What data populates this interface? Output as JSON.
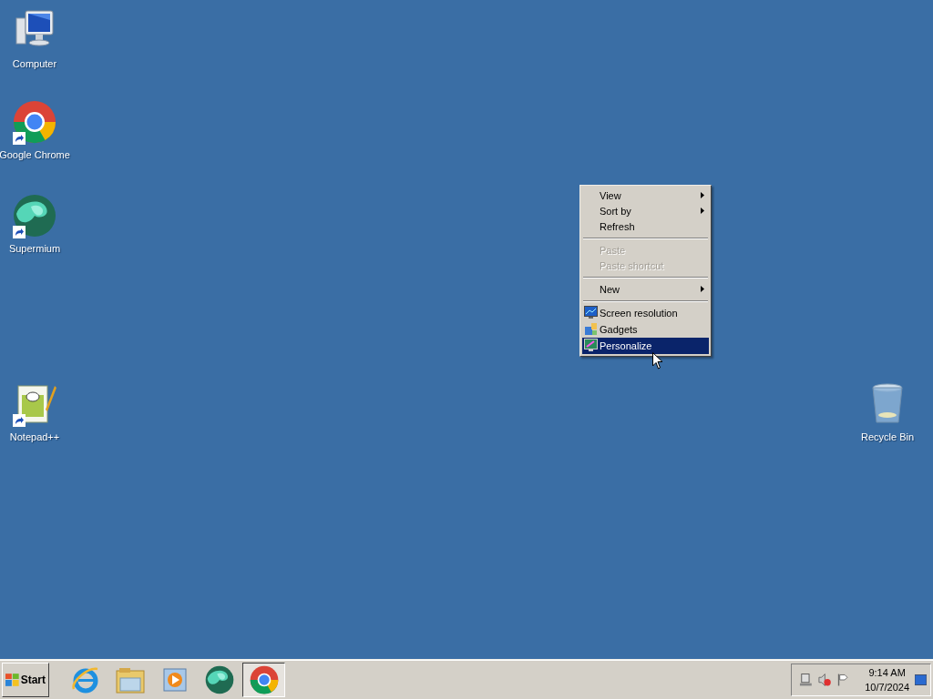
{
  "desktop_icons": [
    {
      "label": "Computer",
      "kind": "computer",
      "shortcut": false
    },
    {
      "label": "Google Chrome",
      "kind": "chrome",
      "shortcut": true
    },
    {
      "label": "Supermium",
      "kind": "supermium",
      "shortcut": true
    },
    {
      "label": "Notepad++",
      "kind": "notepad",
      "shortcut": true
    },
    {
      "label": "Recycle Bin",
      "kind": "recycle",
      "shortcut": false
    }
  ],
  "context_menu": {
    "items": [
      {
        "kind": "item",
        "label": "View",
        "submenu": true,
        "disabled": false,
        "selected": false
      },
      {
        "kind": "item",
        "label": "Sort by",
        "submenu": true,
        "disabled": false,
        "selected": false
      },
      {
        "kind": "item",
        "label": "Refresh",
        "submenu": false,
        "disabled": false,
        "selected": false
      },
      {
        "kind": "separator"
      },
      {
        "kind": "item",
        "label": "Paste",
        "submenu": false,
        "disabled": true,
        "selected": false
      },
      {
        "kind": "item",
        "label": "Paste shortcut",
        "submenu": false,
        "disabled": true,
        "selected": false
      },
      {
        "kind": "separator"
      },
      {
        "kind": "item",
        "label": "New",
        "submenu": true,
        "disabled": false,
        "selected": false
      },
      {
        "kind": "separator"
      },
      {
        "kind": "resolution",
        "label": "Screen resolution",
        "submenu": false,
        "disabled": false,
        "selected": false
      },
      {
        "kind": "gadgets",
        "label": "Gadgets",
        "submenu": false,
        "disabled": false,
        "selected": false
      },
      {
        "kind": "personalize",
        "label": "Personalize",
        "submenu": false,
        "disabled": false,
        "selected": true
      }
    ]
  },
  "taskbar": {
    "start_label": "Start",
    "apps": [
      {
        "kind": "ie",
        "selected": false
      },
      {
        "kind": "explorer",
        "selected": false
      },
      {
        "kind": "media",
        "selected": false
      },
      {
        "kind": "supermium",
        "selected": false
      },
      {
        "kind": "chrome",
        "selected": true
      }
    ],
    "tray": {
      "time": "9:14 AM",
      "date": "10/7/2024"
    }
  }
}
